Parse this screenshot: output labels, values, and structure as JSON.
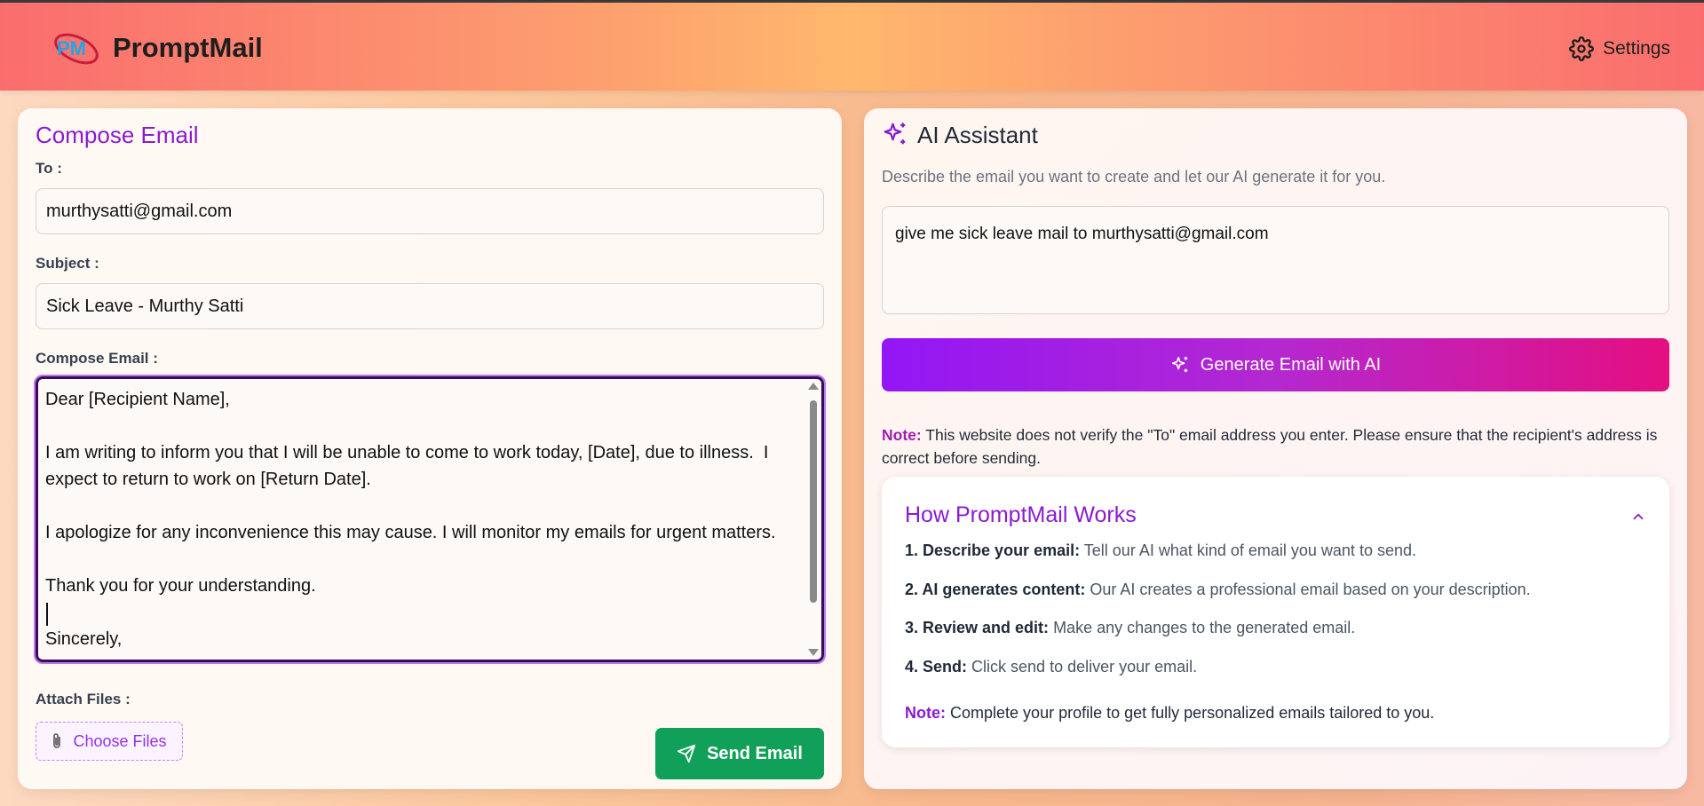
{
  "header": {
    "brand": "PromptMail",
    "logo_icon": "promptmail-logo",
    "settings_label": "Settings"
  },
  "compose": {
    "title": "Compose Email",
    "to_label": "To :",
    "to_value": "murthysatti@gmail.com",
    "subject_label": "Subject :",
    "subject_value": "Sick Leave - Murthy Satti",
    "body_label": "Compose Email :",
    "body_lines": [
      "Dear [Recipient Name],",
      "",
      "I am writing to inform you that I will be unable to come to work today, [Date], due to illness.  I",
      "expect to return to work on [Return Date].",
      "",
      "I apologize for any inconvenience this may cause. I will monitor my emails for urgent matters.",
      "",
      "Thank you for your understanding.",
      "",
      "Sincerely,"
    ],
    "attach_label": "Attach Files :",
    "choose_files_label": "Choose Files",
    "send_label": "Send Email"
  },
  "assistant": {
    "title": "AI Assistant",
    "description": "Describe the email you want to create and let our AI generate it for you.",
    "prompt_value": "give me sick leave mail to murthysatti@gmail.com",
    "generate_label": "Generate Email with AI",
    "note_key": "Note:",
    "note_text": "This website does not verify the \"To\" email address you enter. Please ensure that the recipient's address is correct before sending."
  },
  "how": {
    "title": "How PromptMail Works",
    "steps": [
      {
        "key": "1. Describe your email:",
        "text": "Tell our AI what kind of email you want to send."
      },
      {
        "key": "2. AI generates content:",
        "text": "Our AI creates a professional email based on your description."
      },
      {
        "key": "3. Review and edit:",
        "text": "Make any changes to the generated email."
      },
      {
        "key": "4. Send:",
        "text": "Click send to deliver your email."
      }
    ],
    "note_key": "Note:",
    "note_text": "Complete your profile to get fully personalized emails tailored to you."
  },
  "colors": {
    "accent_purple": "#8a1bd1",
    "send_green": "#11a05a",
    "gradient_start": "#9316f5",
    "gradient_end": "#e40f80"
  }
}
